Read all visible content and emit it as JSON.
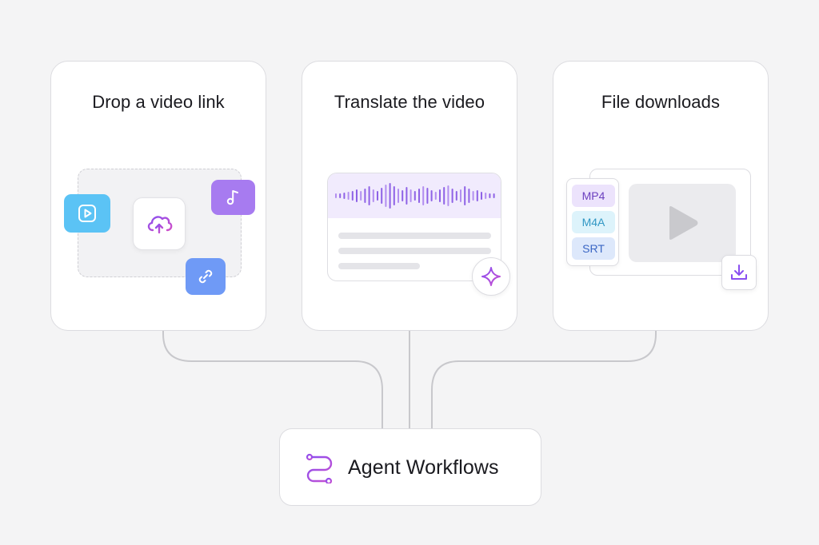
{
  "cards": [
    {
      "title": "Drop a video link"
    },
    {
      "title": "Translate the video"
    },
    {
      "title": "File downloads"
    }
  ],
  "formats": [
    "MP4",
    "M4A",
    "SRT"
  ],
  "workflow": {
    "label": "Agent Workflows"
  },
  "icons": {
    "card1": [
      "video-play-icon",
      "cloud-upload-icon",
      "music-note-icon",
      "link-icon"
    ],
    "card2": [
      "audio-waveform-icon",
      "sparkle-icon"
    ],
    "card3": [
      "play-icon",
      "download-icon"
    ],
    "workflow": "workflow-icon"
  },
  "colors": {
    "background": "#f4f4f5",
    "accent_purple": "#9b5de5",
    "video_chip": "#5bc3f5",
    "music_chip": "#a77bf0",
    "link_chip": "#6f9af6",
    "connector": "#c8c8cc"
  }
}
